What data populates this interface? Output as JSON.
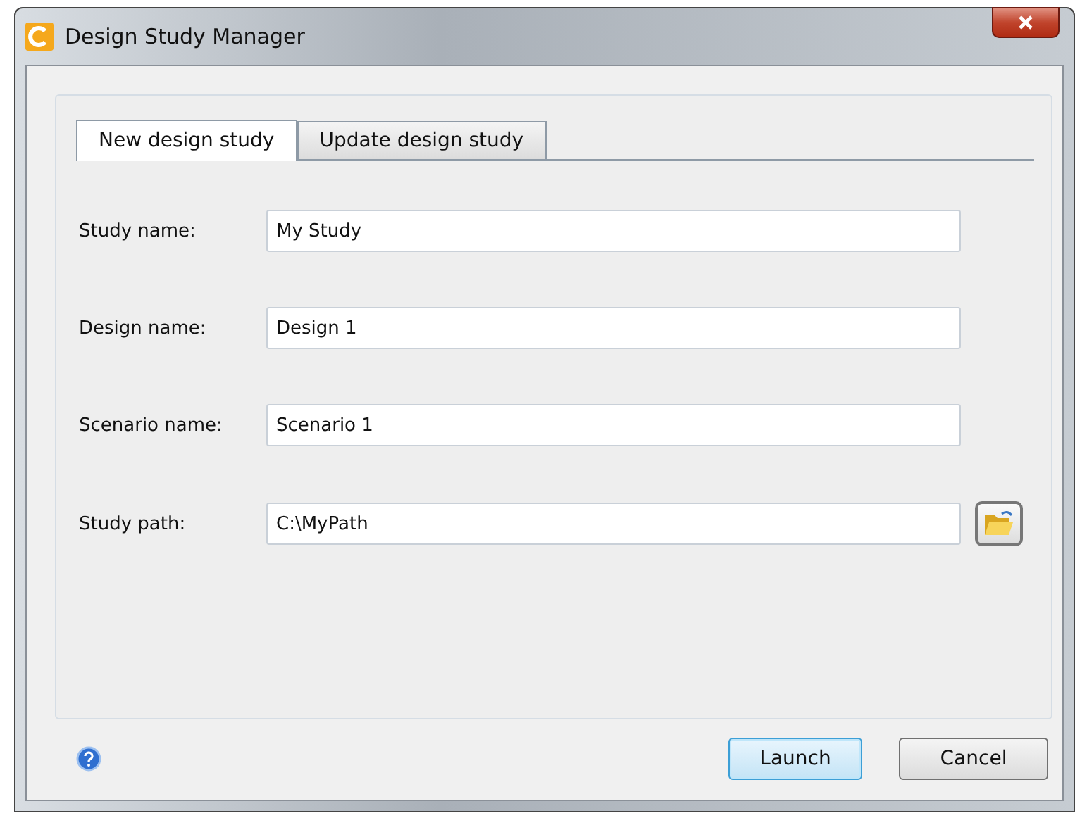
{
  "window": {
    "title": "Design Study Manager"
  },
  "tabs": [
    {
      "label": "New design study",
      "selected": true
    },
    {
      "label": "Update design study",
      "selected": false
    }
  ],
  "fields": [
    {
      "label": "Study name:",
      "value": "My Study",
      "browse": false
    },
    {
      "label": "Design name:",
      "value": "Design 1",
      "browse": false
    },
    {
      "label": "Scenario name:",
      "value": "Scenario 1",
      "browse": false
    },
    {
      "label": "Study path:",
      "value": "C:\\MyPath",
      "browse": true
    }
  ],
  "buttons": [
    {
      "label": "Launch",
      "default": true
    },
    {
      "label": "Cancel",
      "default": false
    }
  ]
}
